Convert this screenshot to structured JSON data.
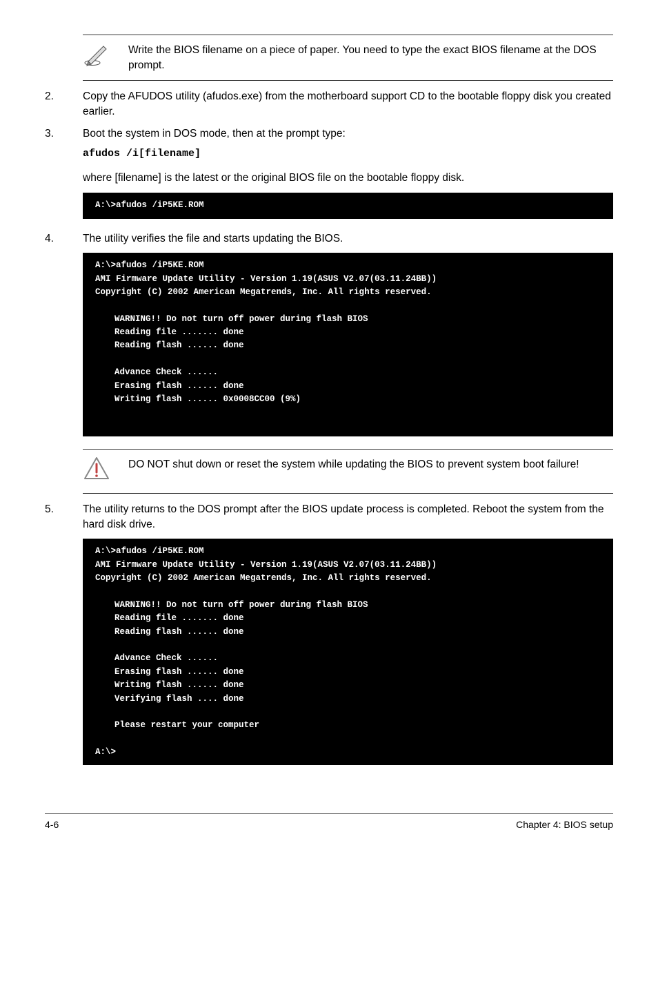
{
  "note1": "Write the BIOS filename on a piece of paper. You need to type the exact BIOS filename at the DOS prompt.",
  "steps": {
    "s2": {
      "num": "2.",
      "text": "Copy the AFUDOS utility (afudos.exe) from the motherboard support CD to the bootable floppy disk you created earlier."
    },
    "s3": {
      "num": "3.",
      "text": "Boot the system in DOS mode, then at the prompt type:"
    },
    "s3code": "afudos /i[filename]",
    "s3b": "where [filename] is the latest or the original BIOS file on the bootable floppy disk.",
    "s4": {
      "num": "4.",
      "text": "The utility verifies the file and starts updating the BIOS."
    },
    "s5": {
      "num": "5.",
      "text": "The utility returns to the DOS prompt after the BIOS update process is completed. Reboot the system from the hard disk drive."
    }
  },
  "term1": "A:\\>afudos /iP5KE.ROM",
  "term2": {
    "l1": "A:\\>afudos /iP5KE.ROM",
    "l2": "AMI Firmware Update Utility - Version 1.19(ASUS V2.07(03.11.24BB))",
    "l3": "Copyright (C) 2002 American Megatrends, Inc. All rights reserved.",
    "l4": "WARNING!! Do not turn off power during flash BIOS",
    "l5": "Reading file ....... done",
    "l6": "Reading flash ...... done",
    "l7": "Advance Check ......",
    "l8": "Erasing flash ...... done",
    "l9": "Writing flash ...... 0x0008CC00 (9%)"
  },
  "warn": "DO NOT shut down or reset the system while updating the BIOS to prevent system boot failure!",
  "term3": {
    "l1": "A:\\>afudos /iP5KE.ROM",
    "l2": "AMI Firmware Update Utility - Version 1.19(ASUS V2.07(03.11.24BB))",
    "l3": "Copyright (C) 2002 American Megatrends, Inc. All rights reserved.",
    "l4": "WARNING!! Do not turn off power during flash BIOS",
    "l5": "Reading file ....... done",
    "l6": "Reading flash ...... done",
    "l7": "Advance Check ......",
    "l8": "Erasing flash ...... done",
    "l9": "Writing flash ...... done",
    "l10": "Verifying flash .... done",
    "l11": "Please restart your computer",
    "l12": "A:\\>"
  },
  "footer": {
    "left": "4-6",
    "right": "Chapter 4: BIOS setup"
  }
}
